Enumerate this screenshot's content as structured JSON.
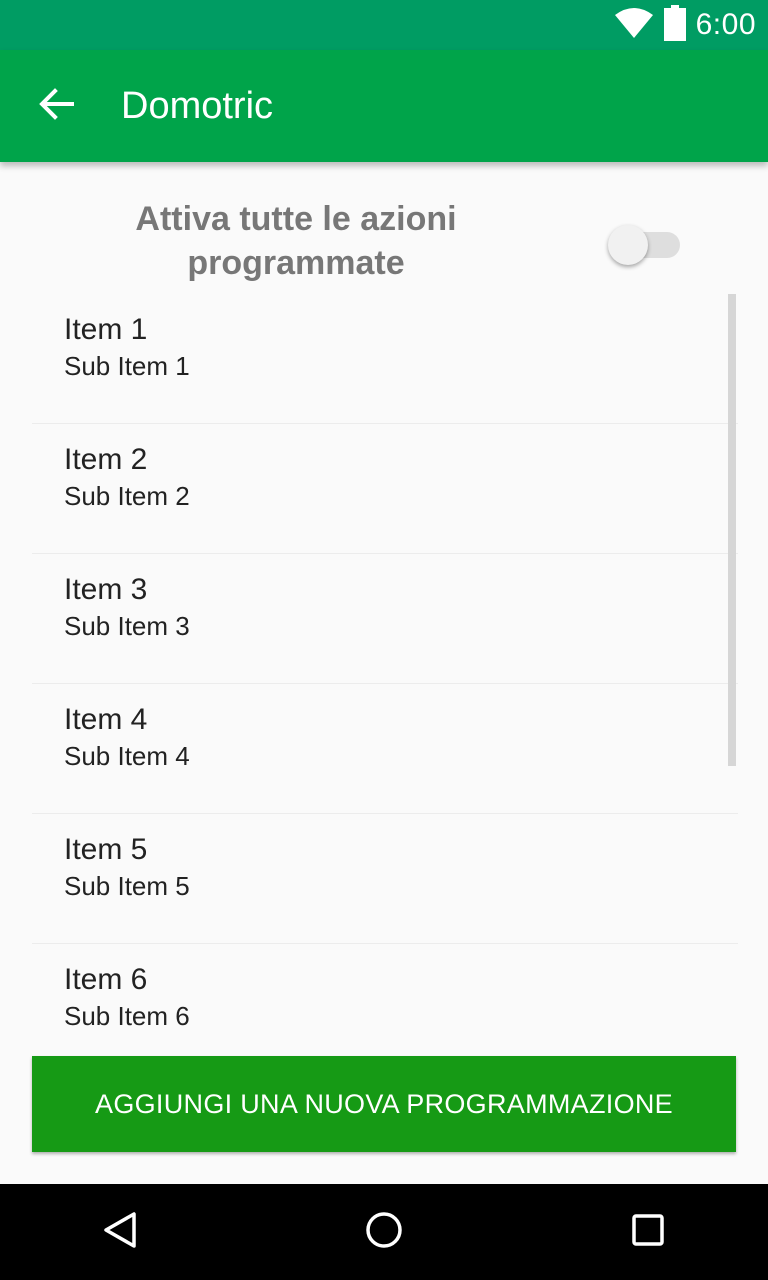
{
  "status_bar": {
    "time": "6:00",
    "icons": [
      "wifi-icon",
      "battery-icon"
    ],
    "background": "#009c63"
  },
  "app_bar": {
    "title": "Domotric",
    "back_icon": "arrow-back-icon",
    "background": "#00a44a"
  },
  "toggle": {
    "label": "Attiva tutte le azioni programmate",
    "state": "off"
  },
  "list": {
    "items": [
      {
        "title": "Item 1",
        "subtitle": "Sub Item 1"
      },
      {
        "title": "Item 2",
        "subtitle": "Sub Item 2"
      },
      {
        "title": "Item 3",
        "subtitle": "Sub Item 3"
      },
      {
        "title": "Item 4",
        "subtitle": "Sub Item 4"
      },
      {
        "title": "Item 5",
        "subtitle": "Sub Item 5"
      },
      {
        "title": "Item 6",
        "subtitle": "Sub Item 6"
      }
    ]
  },
  "add_button": {
    "label": "AGGIUNGI UNA NUOVA PROGRAMMAZIONE",
    "background": "#169a15"
  },
  "nav_bar": {
    "icons": [
      "back-triangle-icon",
      "home-circle-icon",
      "recents-square-icon"
    ]
  }
}
